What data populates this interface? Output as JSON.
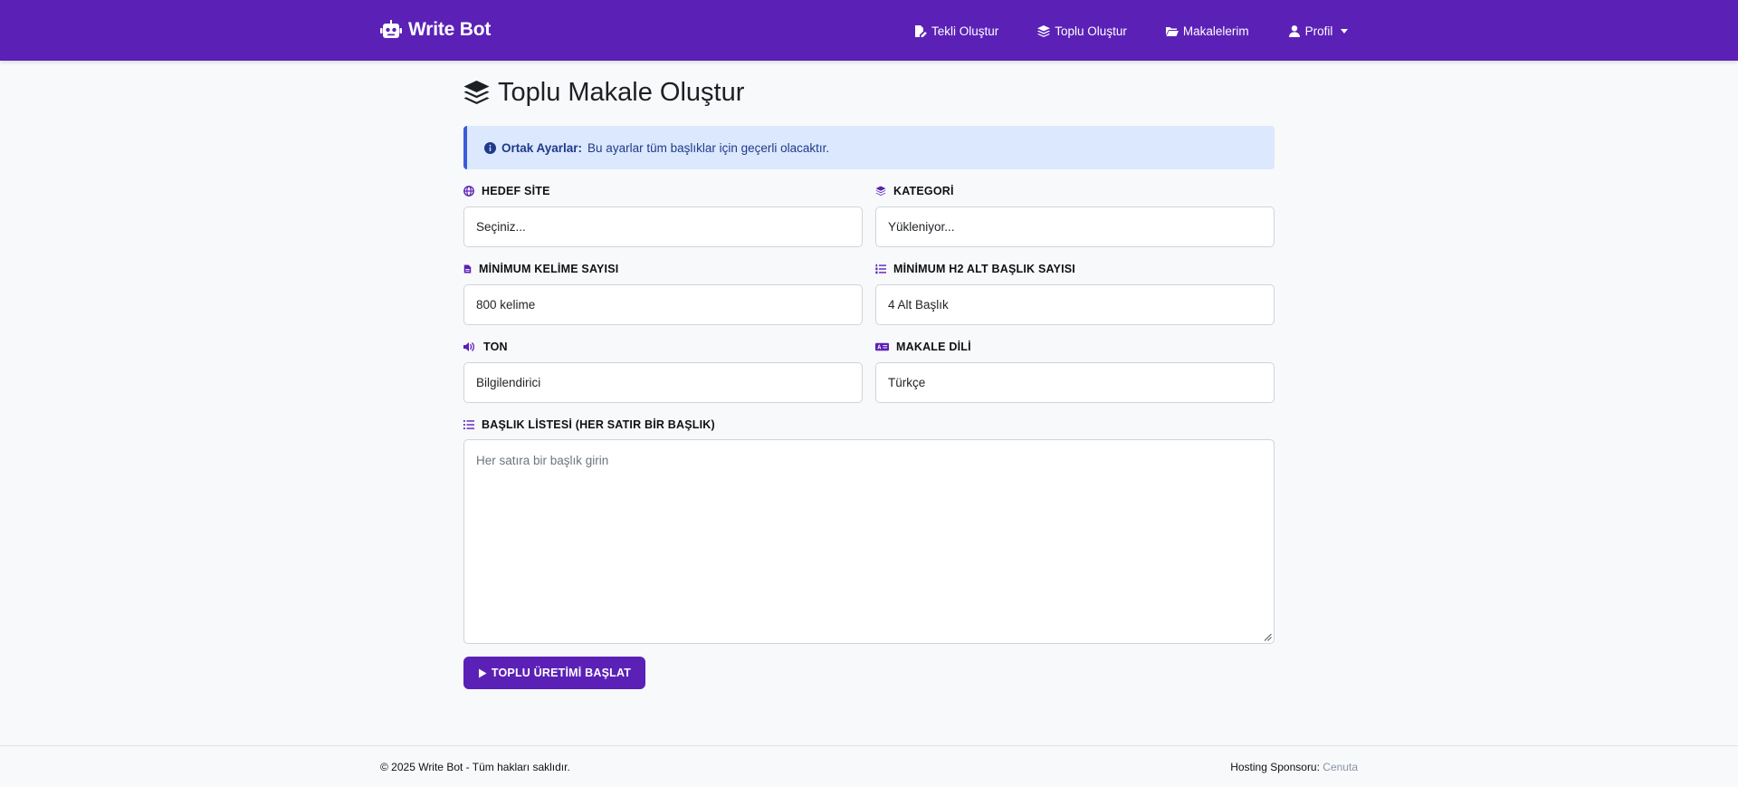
{
  "navbar": {
    "brand": "Write Bot",
    "links": [
      {
        "label": "Tekli Oluştur",
        "icon": "file-pen-icon"
      },
      {
        "label": "Toplu Oluştur",
        "icon": "layer-group-icon"
      },
      {
        "label": "Makalelerim",
        "icon": "folder-open-icon"
      },
      {
        "label": "Profil",
        "icon": "user-icon"
      }
    ]
  },
  "page": {
    "title": "Toplu Makale Oluştur",
    "alert": {
      "strong": "Ortak Ayarlar:",
      "text": "Bu ayarlar tüm başlıklar için geçerli olacaktır."
    }
  },
  "form": {
    "target_site": {
      "label": "HEDEF SİTE",
      "value": "Seçiniz..."
    },
    "category": {
      "label": "KATEGORİ",
      "value": "Yükleniyor..."
    },
    "min_words": {
      "label": "MİNİMUM KELİME SAYISI",
      "value": "800 kelime"
    },
    "min_h2": {
      "label": "MİNİMUM H2 ALT BAŞLIK SAYISI",
      "value": "4 Alt Başlık"
    },
    "tone": {
      "label": "TON",
      "value": "Bilgilendirici"
    },
    "language": {
      "label": "MAKALE DİLİ",
      "value": "Türkçe"
    },
    "titles": {
      "label": "BAŞLIK LİSTESİ (HER SATIR BİR BAŞLIK)",
      "placeholder": "Her satıra bir başlık girin"
    },
    "submit": "TOPLU ÜRETİMİ BAŞLAT"
  },
  "footer": {
    "copyright": "© 2025 Write Bot - Tüm hakları saklıdır.",
    "sponsor_label": "Hosting Sponsoru:",
    "sponsor_link": "Cenuta"
  },
  "colors": {
    "primary": "#5b21b6",
    "alert_bg": "#dce8fd",
    "alert_border": "#3b5bdb",
    "page_bg": "#f8f9fb"
  }
}
